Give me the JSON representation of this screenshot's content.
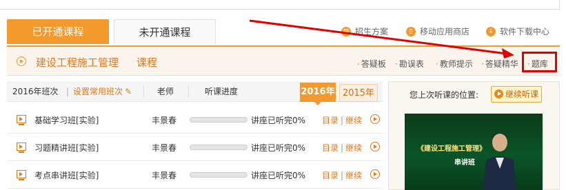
{
  "tabs": {
    "active_label": "已开通课程",
    "inactive_label": "未开通课程"
  },
  "toolbar": {
    "enroll_plan": "招生方案",
    "mobile_store": "移动应用商店",
    "software_download": "软件下载中心"
  },
  "course": {
    "title": "建设工程施工管理",
    "subtitle": "课程",
    "links": {
      "qa_board": "答疑板",
      "errata": "勘误表",
      "teacher_tips": "教师提示",
      "qa_essence": "答疑精华",
      "question_bank": "题库"
    }
  },
  "table": {
    "class_year_label": "2016年班次",
    "separator": "|",
    "set_common_class": "设置常用班次",
    "teacher_header": "老师",
    "progress_header": "听课进度",
    "year_active": "2016年",
    "year_inactive": "2015年",
    "rows": [
      {
        "name": "基础学习班[实验]",
        "teacher": "丰景春",
        "status": "讲座已听完0%",
        "progress": 0,
        "catalog": "目录",
        "sep": "|",
        "continue": "继续"
      },
      {
        "name": "习题精讲班[实验]",
        "teacher": "丰景春",
        "status": "讲座已听完0%",
        "progress": 0,
        "catalog": "目录",
        "sep": "|",
        "continue": "继续"
      },
      {
        "name": "考点串讲班[实验]",
        "teacher": "丰景春",
        "status": "讲座已听完0%",
        "progress": 0,
        "catalog": "目录",
        "sep": "|",
        "continue": "继续"
      }
    ]
  },
  "last_position": {
    "label": "您上次听课的位置:",
    "continue_button": "继续听课",
    "thumb_title": "《建设工程施工管理》",
    "thumb_sub": "串讲班"
  },
  "colors": {
    "accent": "#f39a2e",
    "accent_text": "#e07a1f",
    "annotation_red": "#e00000"
  },
  "icons": {
    "enroll_plan": "document-icon",
    "mobile_store": "phone-icon",
    "software_download": "download-icon",
    "course": "play-circle-icon",
    "row": "video-monitor-icon",
    "go": "play-circle-icon",
    "pencil": "pencil-icon"
  }
}
